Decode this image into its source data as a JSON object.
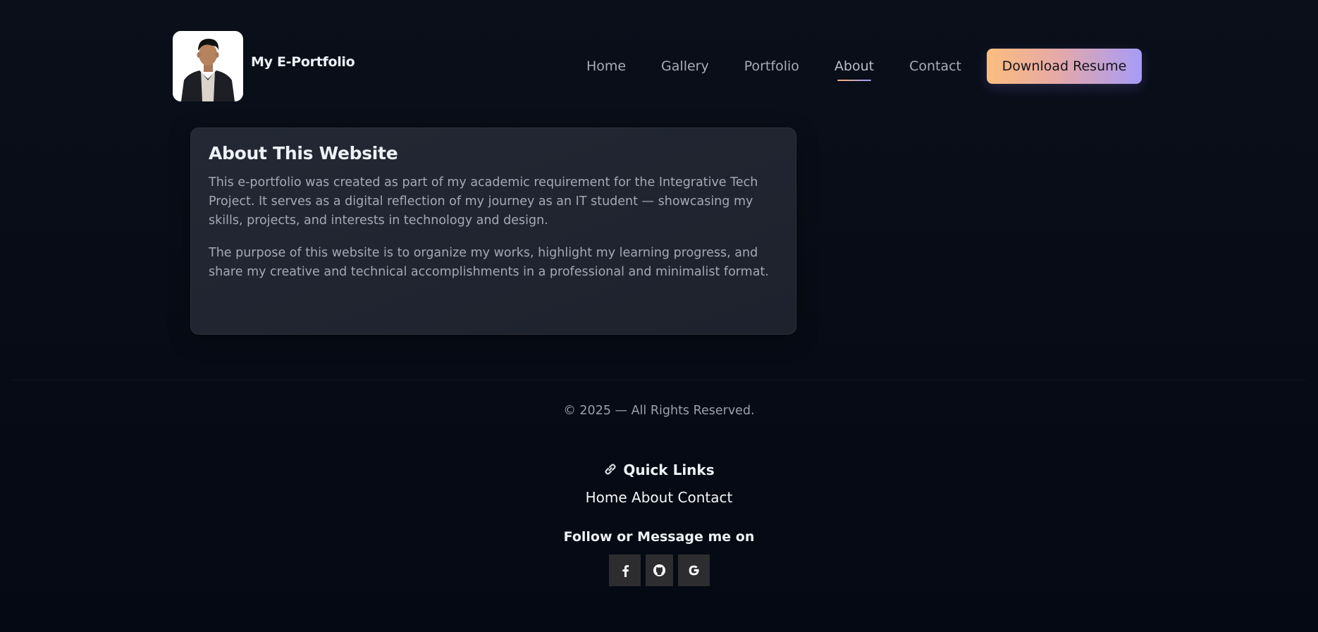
{
  "brand": {
    "title": "My E-Portfolio",
    "avatar_icon": "profile-photo"
  },
  "nav": {
    "items": [
      {
        "label": "Home"
      },
      {
        "label": "Gallery"
      },
      {
        "label": "Portfolio"
      },
      {
        "label": "About",
        "active": true
      },
      {
        "label": "Contact"
      }
    ],
    "resume_label": "Download Resume"
  },
  "about": {
    "title": "About This Website",
    "paragraphs": [
      "This e-portfolio was created as part of my academic requirement for the Integrative Tech Project. It serves as a digital reflection of my journey as an IT student — showcasing my skills, projects, and interests in technology and design.",
      "The purpose of this website is to organize my works, highlight my learning progress, and share my creative and technical accomplishments in a professional and minimalist format."
    ]
  },
  "footer": {
    "copyright": "© 2025 — All Rights Reserved.",
    "quick_links_title": "Quick Links",
    "quick_links": [
      "Home",
      "About",
      "Contact"
    ],
    "follow_title": "Follow or Message me on",
    "socials": [
      {
        "icon": "facebook-icon"
      },
      {
        "icon": "github-icon"
      },
      {
        "icon": "google-icon"
      }
    ]
  },
  "colors": {
    "background": "#070b14",
    "card": "#202531",
    "accent_start": "#fbbd7e",
    "accent_end": "#a79bf8"
  }
}
